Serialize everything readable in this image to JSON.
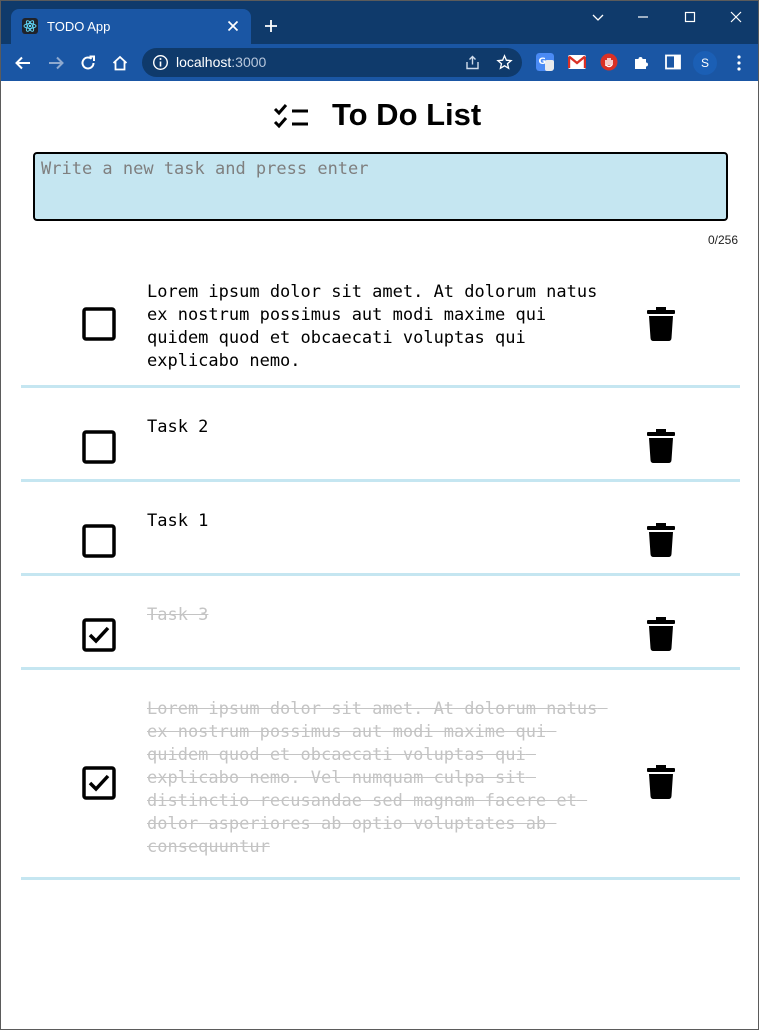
{
  "browser": {
    "tab_title": "TODO App",
    "url_host": "localhost",
    "url_port": ":3000",
    "profile_initial": "S"
  },
  "app": {
    "title": "To Do List",
    "input_placeholder": "Write a new task and press enter",
    "input_value": "",
    "char_counter": "0/256",
    "tasks": [
      {
        "text": "Lorem ipsum dolor sit amet. At dolorum natus ex nostrum possimus aut modi maxime qui quidem quod et obcaecati voluptas qui explicabo nemo.",
        "done": false
      },
      {
        "text": "Task 2",
        "done": false
      },
      {
        "text": "Task 1",
        "done": false
      },
      {
        "text": "Task 3",
        "done": true
      },
      {
        "text": "Lorem ipsum dolor sit amet. At dolorum natus ex nostrum possimus aut modi maxime qui quidem quod et obcaecati voluptas qui explicabo nemo. Vel numquam culpa sit distinctio recusandae sed magnam facere et dolor asperiores ab optio voluptates ab consequuntur",
        "done": true
      }
    ]
  },
  "colors": {
    "accent_light_blue": "#c5e6f1",
    "browser_dark": "#0f3a6b",
    "browser_blue": "#1a56a4",
    "done_text": "#c4c4c4"
  },
  "icons": {
    "header": "checklist-icon",
    "unchecked": "checkbox-empty-icon",
    "checked": "checkbox-checked-icon",
    "delete": "trash-icon"
  }
}
